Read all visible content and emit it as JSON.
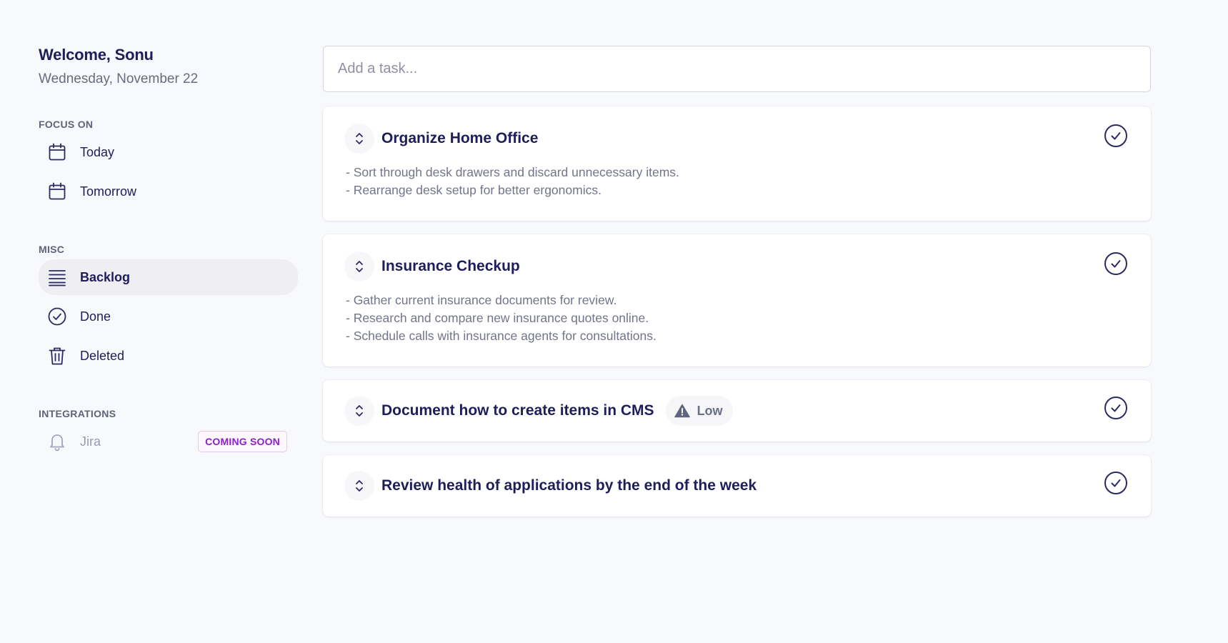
{
  "greeting": {
    "welcome": "Welcome, Sonu",
    "date": "Wednesday, November 22"
  },
  "sidebar": {
    "focus_label": "FOCUS ON",
    "focus_items": [
      {
        "label": "Today",
        "icon": "calendar-icon"
      },
      {
        "label": "Tomorrow",
        "icon": "calendar-icon"
      }
    ],
    "misc_label": "MISC",
    "misc_items": [
      {
        "label": "Backlog",
        "icon": "list-icon",
        "active": true
      },
      {
        "label": "Done",
        "icon": "check-circle-icon"
      },
      {
        "label": "Deleted",
        "icon": "trash-icon"
      }
    ],
    "integrations_label": "INTEGRATIONS",
    "integrations": [
      {
        "label": "Jira",
        "icon": "bell-icon",
        "badge": "COMING SOON"
      }
    ]
  },
  "task_input": {
    "placeholder": "Add a task..."
  },
  "tasks": [
    {
      "title": "Organize Home Office",
      "description": [
        "- Sort through desk drawers and discard unnecessary items.",
        "- Rearrange desk setup for better ergonomics."
      ]
    },
    {
      "title": "Insurance Checkup",
      "description": [
        "- Gather current insurance documents for review.",
        "- Research and compare new insurance quotes online.",
        "- Schedule calls with insurance agents for consultations."
      ]
    },
    {
      "title": "Document how to create items in CMS",
      "priority": "Low"
    },
    {
      "title": "Review health of applications by the end of the week"
    }
  ],
  "colors": {
    "primary": "#1f1d5a",
    "muted": "#72758a",
    "badge_text": "#8b21c8",
    "background": "#f8f9fc"
  }
}
